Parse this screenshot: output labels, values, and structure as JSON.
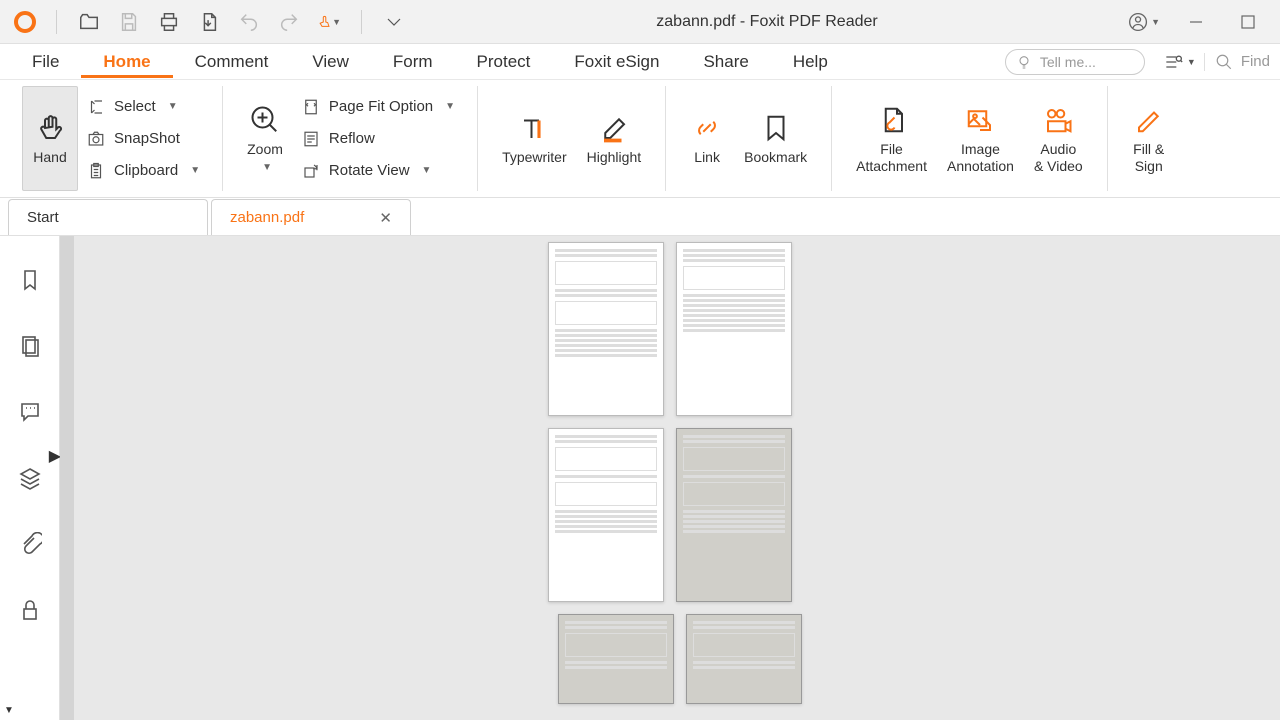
{
  "app": {
    "title": "zabann.pdf - Foxit PDF Reader"
  },
  "menu": {
    "items": [
      "File",
      "Home",
      "Comment",
      "View",
      "Form",
      "Protect",
      "Foxit eSign",
      "Share",
      "Help"
    ],
    "active": "Home",
    "tellme_placeholder": "Tell me...",
    "find_placeholder": "Find"
  },
  "ribbon": {
    "hand": "Hand",
    "select": "Select",
    "snapshot": "SnapShot",
    "clipboard": "Clipboard",
    "zoom": "Zoom",
    "page_fit": "Page Fit Option",
    "reflow": "Reflow",
    "rotate": "Rotate View",
    "typewriter": "Typewriter",
    "highlight": "Highlight",
    "link": "Link",
    "bookmark": "Bookmark",
    "file_attachment": "File\nAttachment",
    "image_annotation": "Image\nAnnotation",
    "audio_video": "Audio\n& Video",
    "fill_sign": "Fill &\nSign"
  },
  "tabs": {
    "start": "Start",
    "doc": "zabann.pdf"
  }
}
